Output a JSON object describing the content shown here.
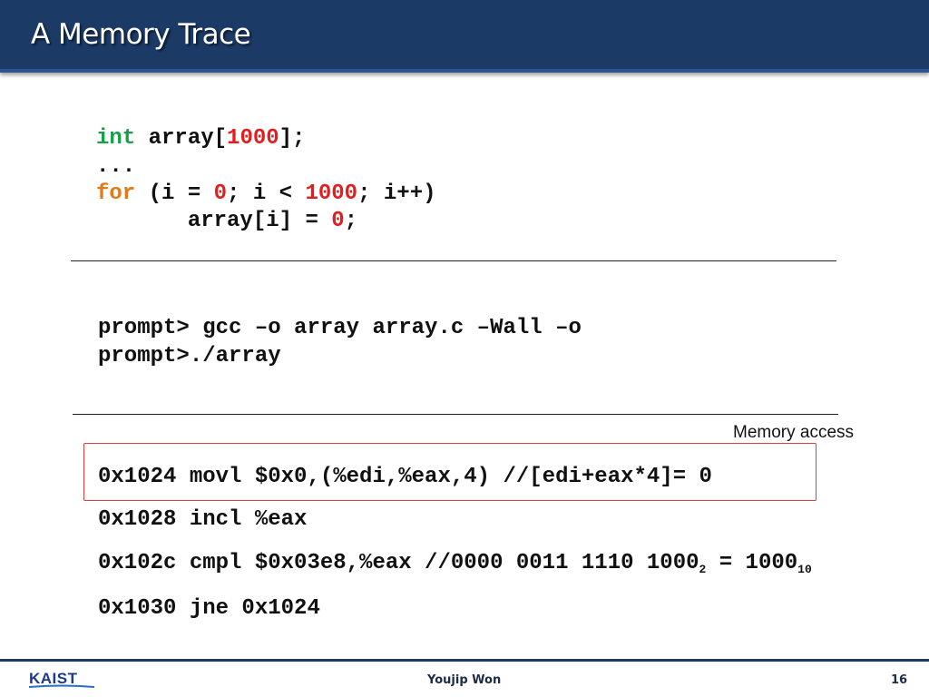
{
  "slide": {
    "title": "A Memory Trace",
    "c_code": {
      "line1": {
        "kw": "int",
        "pre": " array[",
        "num": "1000",
        "post": "];"
      },
      "line2": "...",
      "line3": {
        "kw": "for",
        "a": " (i = ",
        "n1": "0",
        "b": "; i < ",
        "n2": "1000",
        "c": "; i++)"
      },
      "line4": {
        "pre": "       array[i] = ",
        "num": "0",
        "post": ";"
      }
    },
    "commands": [
      "prompt> gcc –o array array.c –Wall –o",
      "prompt>./array"
    ],
    "memory_access_label": "Memory access",
    "assembly": {
      "line1": "0x1024 movl $0x0,(%edi,%eax,4) //[edi+eax*4]= 0",
      "line2": "0x1028 incl %eax",
      "line3": {
        "text": "0x102c cmpl $0x03e8,%eax //0000 0011 1110 1000",
        "sub1": "2",
        "mid": " = 1000",
        "sub2": "10"
      },
      "line4": "0x1030 jne 0x1024"
    },
    "footer": {
      "logo_text": "KAIST",
      "author": "Youjip Won",
      "page_number": "16"
    },
    "colors": {
      "title_bar": "#1b3a66",
      "keyword_type": "#1a9e4a",
      "keyword_control": "#e07b1a",
      "number_literal": "#e02020",
      "highlight_box": "#e03a3a"
    }
  }
}
